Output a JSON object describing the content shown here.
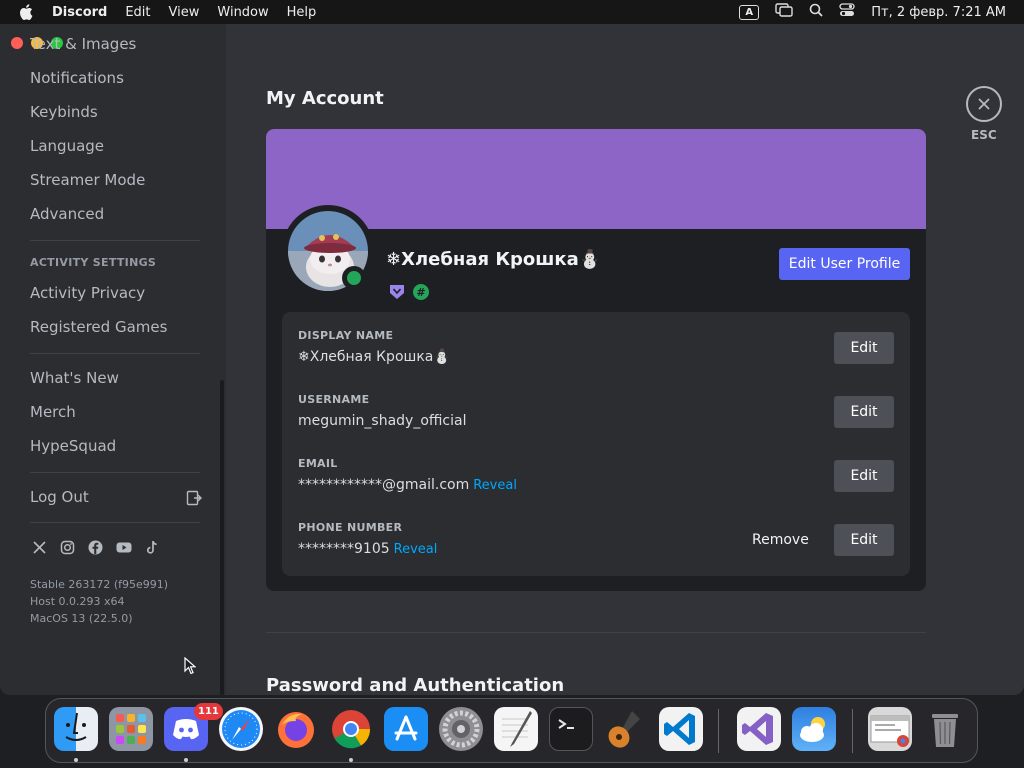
{
  "menubar": {
    "app_name": "Discord",
    "menus": [
      "Edit",
      "View",
      "Window",
      "Help"
    ],
    "input_indicator": "A",
    "clock": "Пт, 2 февр. 7:21 AM"
  },
  "sidebar": {
    "items_top": [
      "Text & Images",
      "Notifications",
      "Keybinds",
      "Language",
      "Streamer Mode",
      "Advanced"
    ],
    "activity_heading": "ACTIVITY SETTINGS",
    "activity_items": [
      "Activity Privacy",
      "Registered Games"
    ],
    "misc_items": [
      "What's New",
      "Merch",
      "HypeSquad"
    ],
    "logout_label": "Log Out",
    "socials": [
      "x-icon",
      "instagram-icon",
      "facebook-icon",
      "youtube-icon",
      "tiktok-icon"
    ],
    "version": {
      "stable": "Stable 263172 (f95e991)",
      "host": "Host 0.0.293 x64",
      "os": "MacOS 13 (22.5.0)"
    }
  },
  "account": {
    "title": "My Account",
    "banner_color": "#8c65c7",
    "profile_name": "❄Хлебная Крошка⛄",
    "edit_profile_label": "Edit User Profile",
    "fields": {
      "display_name": {
        "label": "DISPLAY NAME",
        "value": "❄Хлебная Крошка⛄",
        "edit": "Edit"
      },
      "username": {
        "label": "USERNAME",
        "value": "megumin_shady_official",
        "edit": "Edit"
      },
      "email": {
        "label": "EMAIL",
        "value": "************@gmail.com",
        "reveal": "Reveal",
        "edit": "Edit"
      },
      "phone": {
        "label": "PHONE NUMBER",
        "value": "********9105",
        "reveal": "Reveal",
        "remove": "Remove",
        "edit": "Edit"
      }
    },
    "next_section_title": "Password and Authentication",
    "esc_label": "ESC"
  },
  "dock": {
    "apps": [
      "Finder",
      "Launchpad",
      "Discord",
      "Safari",
      "Firefox",
      "Chrome",
      "App Store",
      "System Settings",
      "TextEdit",
      "Terminal",
      "GarageBand",
      "Visual Studio Code",
      "Visual Studio",
      "Weather",
      "Chrome Window",
      "Trash"
    ],
    "discord_badge": "111"
  },
  "colors": {
    "accent": "#5865f2",
    "online": "#23a55a",
    "link": "#00a8fc",
    "badge": "#e5383b"
  }
}
